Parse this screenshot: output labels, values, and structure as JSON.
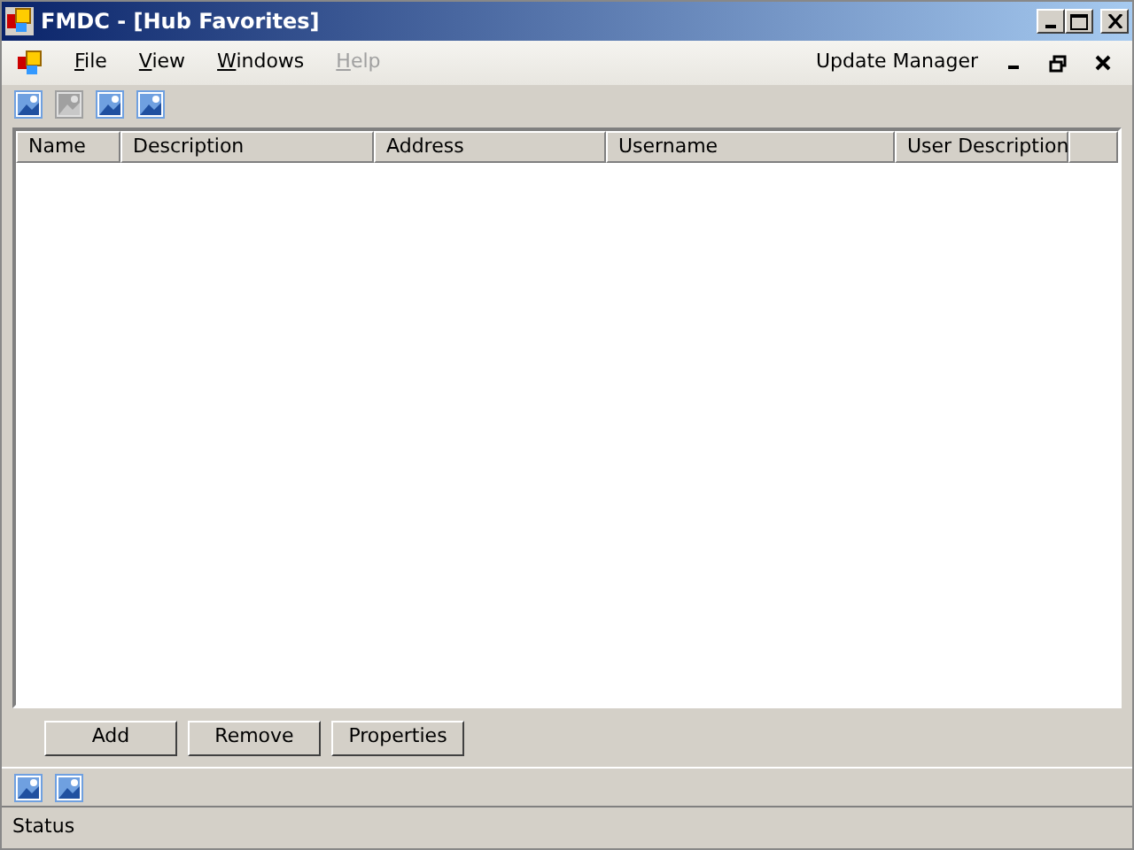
{
  "window": {
    "title": "FMDC - [Hub Favorites]"
  },
  "menu": [
    {
      "label": "File",
      "disabled": false
    },
    {
      "label": "View",
      "disabled": false
    },
    {
      "label": "Windows",
      "disabled": false
    },
    {
      "label": "Help",
      "disabled": true
    }
  ],
  "menu_right": {
    "label": "Update Manager"
  },
  "toolbar": [
    {
      "disabled": false
    },
    {
      "disabled": true
    },
    {
      "disabled": false
    },
    {
      "disabled": false
    }
  ],
  "table": {
    "columns": [
      "Name",
      "Description",
      "Address",
      "Username",
      "User Description"
    ]
  },
  "buttons": [
    "Add",
    "Remove",
    "Properties"
  ],
  "bottom_toolbar": [
    {
      "disabled": false
    },
    {
      "disabled": false
    }
  ],
  "status_bar": "Status"
}
